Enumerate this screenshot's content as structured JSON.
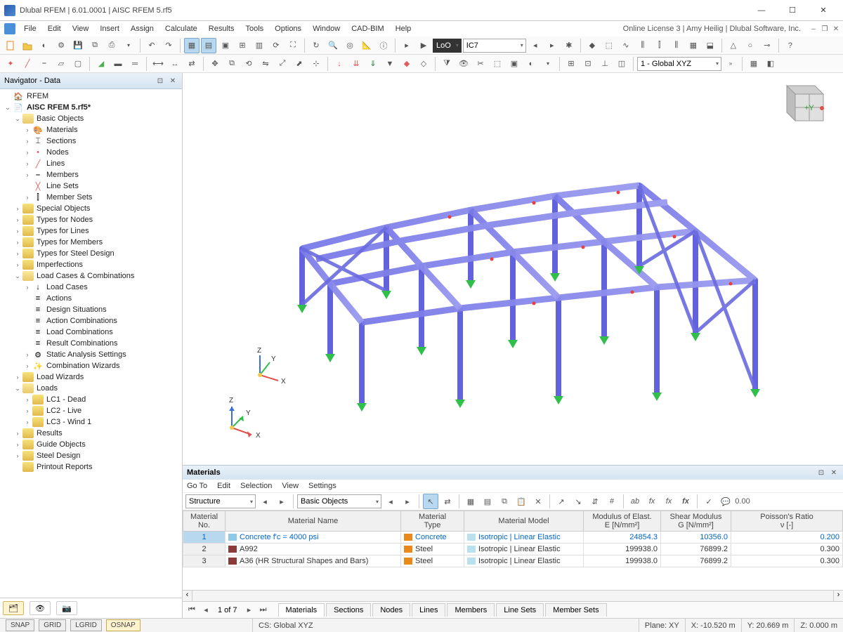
{
  "titlebar": {
    "title": "Dlubal RFEM | 6.01.0001 | AISC RFEM 5.rf5",
    "min": "—",
    "max": "☐",
    "close": "✕"
  },
  "menubar": {
    "file": "File",
    "edit": "Edit",
    "view": "View",
    "insert": "Insert",
    "assign": "Assign",
    "calculate": "Calculate",
    "results": "Results",
    "tools": "Tools",
    "options": "Options",
    "window": "Window",
    "cadbim": "CAD-BIM",
    "help": "Help",
    "rightinfo": "Online License 3 | Amy Heilig | Dlubal Software, Inc."
  },
  "toolbar1": {
    "loadcase_dark": "LoO",
    "loadcase_combo": "IC7",
    "worksys_combo": "1 - Global XYZ"
  },
  "navigator": {
    "title": "Navigator - Data",
    "root": "RFEM",
    "model": "AISC RFEM 5.rf5*",
    "basic": "Basic Objects",
    "materials": "Materials",
    "sections": "Sections",
    "nodes": "Nodes",
    "lines": "Lines",
    "members": "Members",
    "linesets": "Line Sets",
    "membersets": "Member Sets",
    "special": "Special Objects",
    "typesnodes": "Types for Nodes",
    "typeslines": "Types for Lines",
    "typesmembers": "Types for Members",
    "typessteel": "Types for Steel Design",
    "imperf": "Imperfections",
    "lcc": "Load Cases & Combinations",
    "loadcases": "Load Cases",
    "actions": "Actions",
    "designsit": "Design Situations",
    "actioncomb": "Action Combinations",
    "loadcomb": "Load Combinations",
    "resultcomb": "Result Combinations",
    "staticanalysis": "Static Analysis Settings",
    "combwiz": "Combination Wizards",
    "loadwiz": "Load Wizards",
    "loads": "Loads",
    "lc1": "LC1 - Dead",
    "lc2": "LC2 - Live",
    "lc3": "LC3 - Wind 1",
    "results": "Results",
    "guide": "Guide Objects",
    "steeldesign": "Steel Design",
    "printout": "Printout Reports"
  },
  "navcube": {
    "y_label": "+Y"
  },
  "bpanel": {
    "title": "Materials",
    "menu": {
      "goto": "Go To",
      "edit": "Edit",
      "selection": "Selection",
      "view": "View",
      "settings": "Settings"
    },
    "combo1": "Structure",
    "combo2": "Basic Objects",
    "headers": {
      "no": "Material\nNo.",
      "name": "Material Name",
      "type": "Material\nType",
      "model": "Material Model",
      "emod": "Modulus of Elast.\nE [N/mm²]",
      "gmod": "Shear Modulus\nG [N/mm²]",
      "poisson": "Poisson's Ratio\nν [-]"
    },
    "rows": [
      {
        "no": "1",
        "name": "Concrete f'c = 4000 psi",
        "type": "Concrete",
        "model": "Isotropic | Linear Elastic",
        "e": "24854.3",
        "g": "10356.0",
        "v": "0.200",
        "swName": "#8ecae6",
        "swType": "#e8891a",
        "swModel": "#b8e0ee",
        "selected": true
      },
      {
        "no": "2",
        "name": "A992",
        "type": "Steel",
        "model": "Isotropic | Linear Elastic",
        "e": "199938.0",
        "g": "76899.2",
        "v": "0.300",
        "swName": "#8d3a3a",
        "swType": "#e8891a",
        "swModel": "#b8e0ee",
        "selected": false
      },
      {
        "no": "3",
        "name": "A36 (HR Structural Shapes and Bars)",
        "type": "Steel",
        "model": "Isotropic | Linear Elastic",
        "e": "199938.0",
        "g": "76899.2",
        "v": "0.300",
        "swName": "#8d3a3a",
        "swType": "#e8891a",
        "swModel": "#b8e0ee",
        "selected": false
      }
    ],
    "pager": "1 of 7",
    "tabs": [
      "Materials",
      "Sections",
      "Nodes",
      "Lines",
      "Members",
      "Line Sets",
      "Member Sets"
    ],
    "activeTab": 0
  },
  "status": {
    "snap": "SNAP",
    "grid": "GRID",
    "lgrid": "LGRID",
    "osnap": "OSNAP",
    "cs": "CS: Global XYZ",
    "plane": "Plane: XY",
    "x": "X: -10.520 m",
    "y": "Y: 20.669 m",
    "z": "Z: 0.000 m"
  }
}
